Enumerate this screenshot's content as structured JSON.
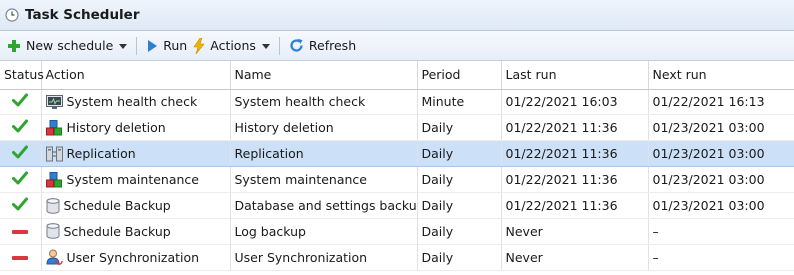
{
  "window": {
    "title": "Task Scheduler"
  },
  "toolbar": {
    "new_schedule": "New schedule",
    "run": "Run",
    "actions": "Actions",
    "refresh": "Refresh"
  },
  "table": {
    "columns": [
      "Status",
      "Action",
      "Name",
      "Period",
      "Last run",
      "Next run"
    ],
    "rows": [
      {
        "status": "ok",
        "icon": "monitor-icon",
        "action": "System health check",
        "name": "System health check",
        "period": "Minute",
        "last_run": "01/22/2021 16:03",
        "next_run": "01/22/2021 16:13",
        "selected": false
      },
      {
        "status": "ok",
        "icon": "blocks-icon",
        "action": "History deletion",
        "name": "History deletion",
        "period": "Daily",
        "last_run": "01/22/2021 11:36",
        "next_run": "01/23/2021 03:00",
        "selected": false
      },
      {
        "status": "ok",
        "icon": "replication-icon",
        "action": "Replication",
        "name": "Replication",
        "period": "Daily",
        "last_run": "01/22/2021 11:36",
        "next_run": "01/23/2021 03:00",
        "selected": true
      },
      {
        "status": "ok",
        "icon": "blocks-icon",
        "action": "System maintenance",
        "name": "System maintenance",
        "period": "Daily",
        "last_run": "01/22/2021 11:36",
        "next_run": "01/23/2021 03:00",
        "selected": false
      },
      {
        "status": "ok",
        "icon": "database-icon",
        "action": "Schedule Backup",
        "name": "Database and settings backup",
        "period": "Daily",
        "last_run": "01/22/2021 11:36",
        "next_run": "01/23/2021 03:00",
        "selected": false
      },
      {
        "status": "disabled",
        "icon": "database-icon",
        "action": "Schedule Backup",
        "name": "Log backup",
        "period": "Daily",
        "last_run": "Never",
        "next_run": "–",
        "selected": false
      },
      {
        "status": "disabled",
        "icon": "user-sync-icon",
        "action": "User Synchronization",
        "name": "User Synchronization",
        "period": "Daily",
        "last_run": "Never",
        "next_run": "–",
        "selected": false
      }
    ]
  },
  "colors": {
    "ok": "#2ea52e",
    "disabled": "#d9363e",
    "selected_row": "#cce0f7",
    "toolbar_bg": "#e7eef8"
  }
}
